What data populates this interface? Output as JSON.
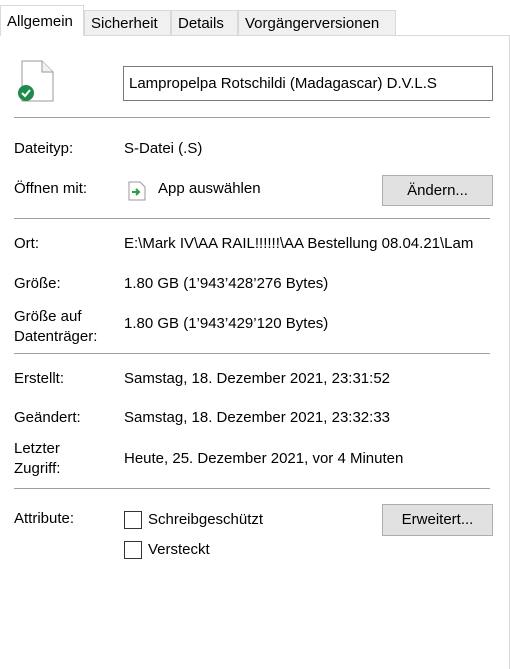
{
  "tabs": [
    "Allgemein",
    "Sicherheit",
    "Details",
    "Vorgängerversionen"
  ],
  "file_name": "Lampropelpa Rotschildi (Madagascar) D.V.L.S",
  "labels": {
    "type": "Dateityp:",
    "open_with": "Öffnen mit:",
    "location": "Ort:",
    "size": "Größe:",
    "size_on_disk_1": "Größe auf",
    "size_on_disk_2": "Datenträger:",
    "created": "Erstellt:",
    "modified": "Geändert:",
    "accessed_1": "Letzter",
    "accessed_2": "Zugriff:",
    "attributes": "Attribute:"
  },
  "values": {
    "type": "S-Datei (.S)",
    "open_with": "App auswählen",
    "location": "E:\\Mark IV\\AA RAIL!!!!!!\\AA Bestellung 08.04.21\\Lam",
    "size": "1.80 GB (1’943’428’276 Bytes)",
    "size_on_disk": "1.80 GB (1’943’429’120 Bytes)",
    "created": "Samstag, 18. Dezember 2021, 23:31:52",
    "modified": "Samstag, 18. Dezember 2021, 23:32:33",
    "accessed": "Heute, 25. Dezember 2021, vor 4 Minuten"
  },
  "buttons": {
    "change": "Ändern...",
    "advanced": "Erweitert..."
  },
  "attributes": {
    "readonly": {
      "label": "Schreibgeschützt",
      "checked": false
    },
    "hidden": {
      "label": "Versteckt",
      "checked": false
    }
  }
}
